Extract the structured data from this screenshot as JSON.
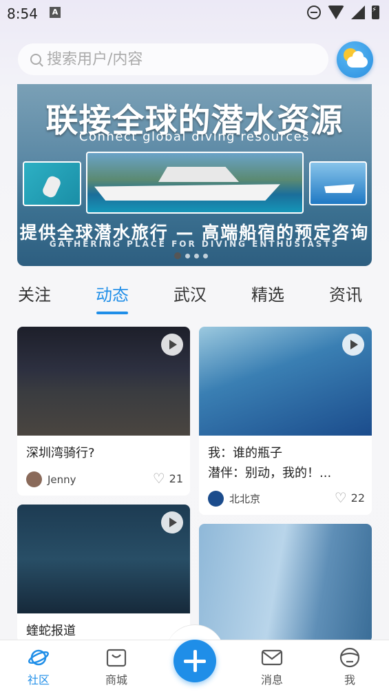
{
  "status_bar": {
    "time": "8:54",
    "notif_letter": "A"
  },
  "search": {
    "placeholder": "搜索用户/内容"
  },
  "banner": {
    "title": "联接全球的潜水资源",
    "subtitle": "Connect global diving resources",
    "line1": "提供全球潜水旅行 — 高端船宿的预定咨询",
    "line2": "GATHERING PLACE FOR DIVING ENTHUSIASTS",
    "active_slide": 1,
    "slide_count": 4
  },
  "tabs": [
    {
      "label": "关注",
      "active": false
    },
    {
      "label": "动态",
      "active": true
    },
    {
      "label": "武汉",
      "active": false
    },
    {
      "label": "精选",
      "active": false
    },
    {
      "label": "资讯",
      "active": false
    }
  ],
  "feed": [
    {
      "title": "深圳湾骑行?",
      "author": "Jenny",
      "likes": "21",
      "has_video": true
    },
    {
      "title_line1": "我：谁的瓶子",
      "title_line2": "潜伴：别动，我的！...",
      "author": "北北京",
      "likes": "22",
      "has_video": true
    },
    {
      "title": "蝰蛇报道",
      "has_video": true
    },
    {
      "title": ""
    }
  ],
  "bottom_nav": {
    "community": "社区",
    "shop": "商城",
    "messages": "消息",
    "me": "我"
  },
  "colors": {
    "accent": "#1f8ee8"
  }
}
